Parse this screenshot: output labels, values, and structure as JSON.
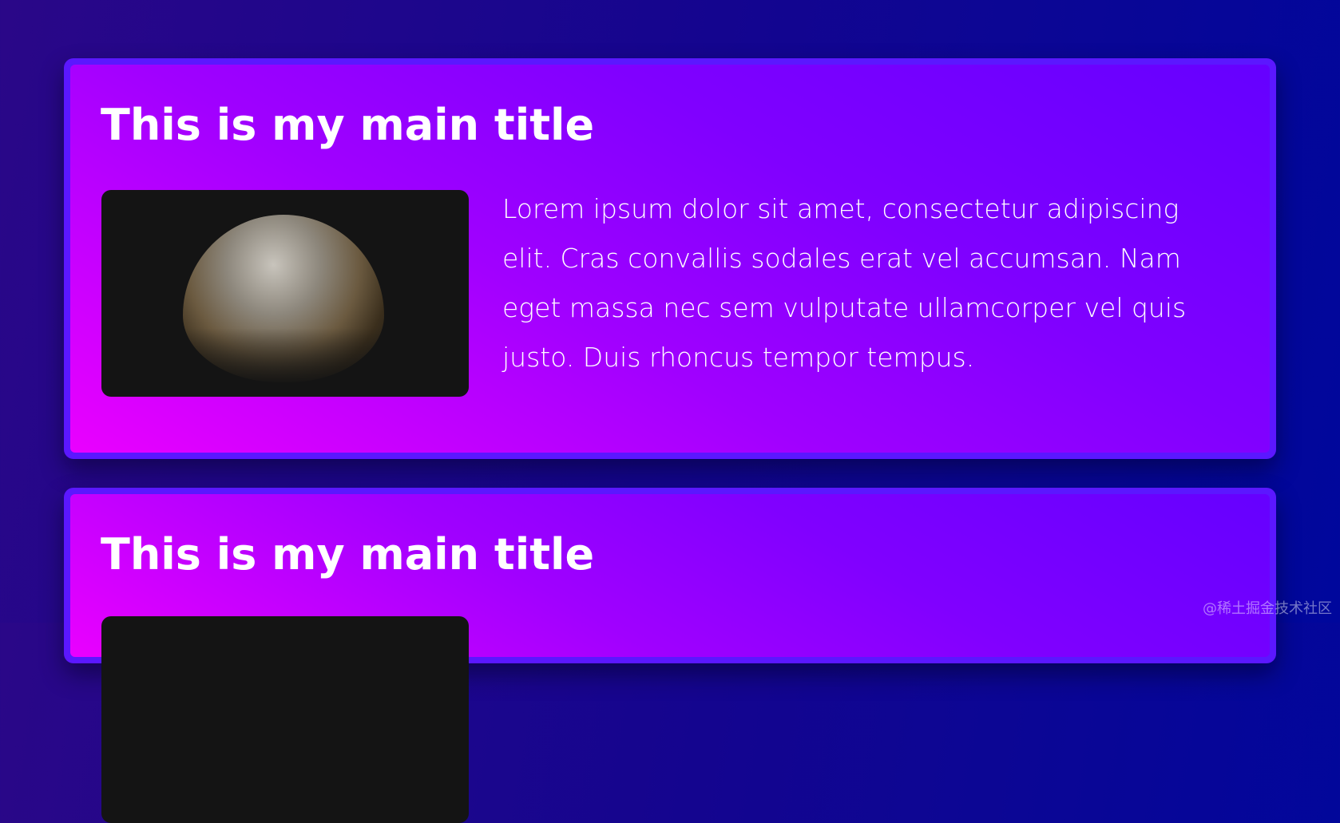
{
  "cards": [
    {
      "title": "This is my main title",
      "body": "Lorem ipsum dolor sit amet, consectetur adipiscing elit. Cras convallis sodales erat vel accumsan. Nam eget massa nec sem vulputate ullamcorper vel quis justo. Duis rhoncus tempor tempus.",
      "image": "moon-photo"
    },
    {
      "title": "This is my main title"
    }
  ],
  "watermark": "@稀土掘金技术社区",
  "colors": {
    "background": "#14058f",
    "card_border": "#5b17ff",
    "gradient_start": "#ea00ff",
    "gradient_end": "#6500ff"
  }
}
